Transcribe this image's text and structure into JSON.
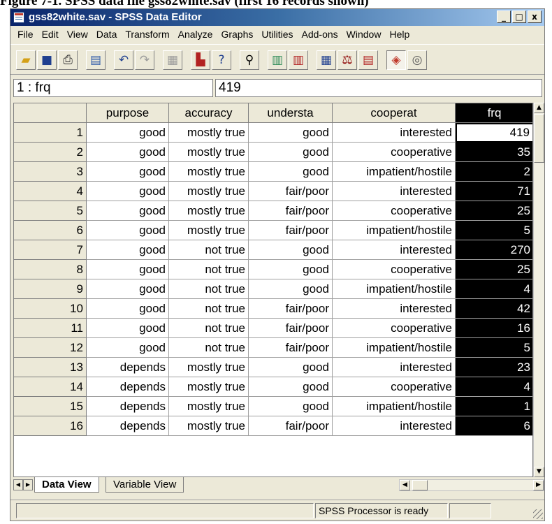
{
  "caption": "Figure 7-1. SPSS data file gss82white.sav (first 16 records shown)",
  "window": {
    "title": "gss82white.sav - SPSS Data Editor",
    "buttons": [
      "_",
      "□",
      "x"
    ]
  },
  "menu": [
    "File",
    "Edit",
    "View",
    "Data",
    "Transform",
    "Analyze",
    "Graphs",
    "Utilities",
    "Add-ons",
    "Window",
    "Help"
  ],
  "toolbar_icons": [
    "open-icon",
    "save-icon",
    "print-icon",
    "dialog-recall-icon",
    "undo-icon",
    "redo-icon",
    "goto-chart-icon",
    "goto-case-icon",
    "variables-icon",
    "find-icon",
    "insert-cases-icon",
    "insert-variable-icon",
    "split-file-icon",
    "weight-cases-icon",
    "select-cases-icon",
    "value-labels-icon",
    "use-sets-icon"
  ],
  "cell_ref": "1 : frq",
  "cell_value": "419",
  "columns": [
    "purpose",
    "accuracy",
    "understa",
    "cooperat",
    "frq"
  ],
  "rows": [
    [
      "1",
      "good",
      "mostly true",
      "good",
      "interested",
      "419"
    ],
    [
      "2",
      "good",
      "mostly true",
      "good",
      "cooperative",
      "35"
    ],
    [
      "3",
      "good",
      "mostly true",
      "good",
      "impatient/hostile",
      "2"
    ],
    [
      "4",
      "good",
      "mostly true",
      "fair/poor",
      "interested",
      "71"
    ],
    [
      "5",
      "good",
      "mostly true",
      "fair/poor",
      "cooperative",
      "25"
    ],
    [
      "6",
      "good",
      "mostly true",
      "fair/poor",
      "impatient/hostile",
      "5"
    ],
    [
      "7",
      "good",
      "not true",
      "good",
      "interested",
      "270"
    ],
    [
      "8",
      "good",
      "not true",
      "good",
      "cooperative",
      "25"
    ],
    [
      "9",
      "good",
      "not true",
      "good",
      "impatient/hostile",
      "4"
    ],
    [
      "10",
      "good",
      "not true",
      "fair/poor",
      "interested",
      "42"
    ],
    [
      "11",
      "good",
      "not true",
      "fair/poor",
      "cooperative",
      "16"
    ],
    [
      "12",
      "good",
      "not true",
      "fair/poor",
      "impatient/hostile",
      "5"
    ],
    [
      "13",
      "depends",
      "mostly true",
      "good",
      "interested",
      "23"
    ],
    [
      "14",
      "depends",
      "mostly true",
      "good",
      "cooperative",
      "4"
    ],
    [
      "15",
      "depends",
      "mostly true",
      "good",
      "impatient/hostile",
      "1"
    ],
    [
      "16",
      "depends",
      "mostly true",
      "fair/poor",
      "interested",
      "6"
    ]
  ],
  "tabs": [
    "Data View",
    "Variable View"
  ],
  "status": "SPSS Processor  is ready",
  "colors": {
    "titlebar_start": "#0a246a",
    "titlebar_end": "#a6caf0",
    "selected_column": "#000000",
    "chrome": "#ece9d8"
  }
}
